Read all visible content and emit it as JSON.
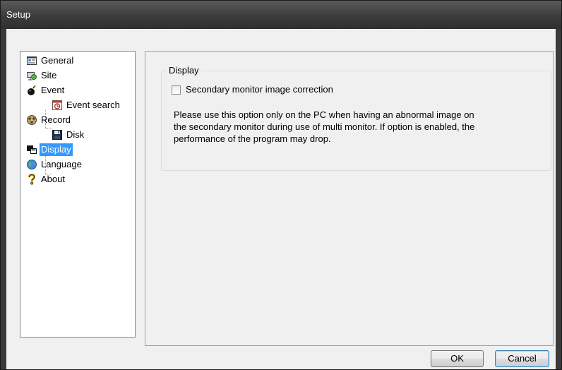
{
  "window": {
    "title": "Setup"
  },
  "tree": {
    "items": [
      {
        "label": "General",
        "icon": "general-icon",
        "depth": 0
      },
      {
        "label": "Site",
        "icon": "site-icon",
        "depth": 0
      },
      {
        "label": "Event",
        "icon": "event-icon",
        "depth": 0
      },
      {
        "label": "Event search",
        "icon": "event-search-icon",
        "depth": 1
      },
      {
        "label": "Record",
        "icon": "record-icon",
        "depth": 0
      },
      {
        "label": "Disk",
        "icon": "disk-icon",
        "depth": 1
      },
      {
        "label": "Display",
        "icon": "display-icon",
        "depth": 0,
        "selected": true
      },
      {
        "label": "Language",
        "icon": "language-icon",
        "depth": 0
      },
      {
        "label": "About",
        "icon": "about-icon",
        "depth": 0
      }
    ]
  },
  "display_panel": {
    "group_title": "Display",
    "checkbox_label": "Secondary monitor image correction",
    "checkbox_checked": false,
    "description_lines": [
      "Please use this option only on the PC when having an abnormal image on",
      "the secondary monitor during use of multi monitor. If option is enabled, the",
      "performance of the program may drop."
    ]
  },
  "buttons": {
    "ok": "OK",
    "cancel": "Cancel"
  },
  "colors": {
    "selection": "#3399ff",
    "titlebar": "#3a3a3a"
  }
}
